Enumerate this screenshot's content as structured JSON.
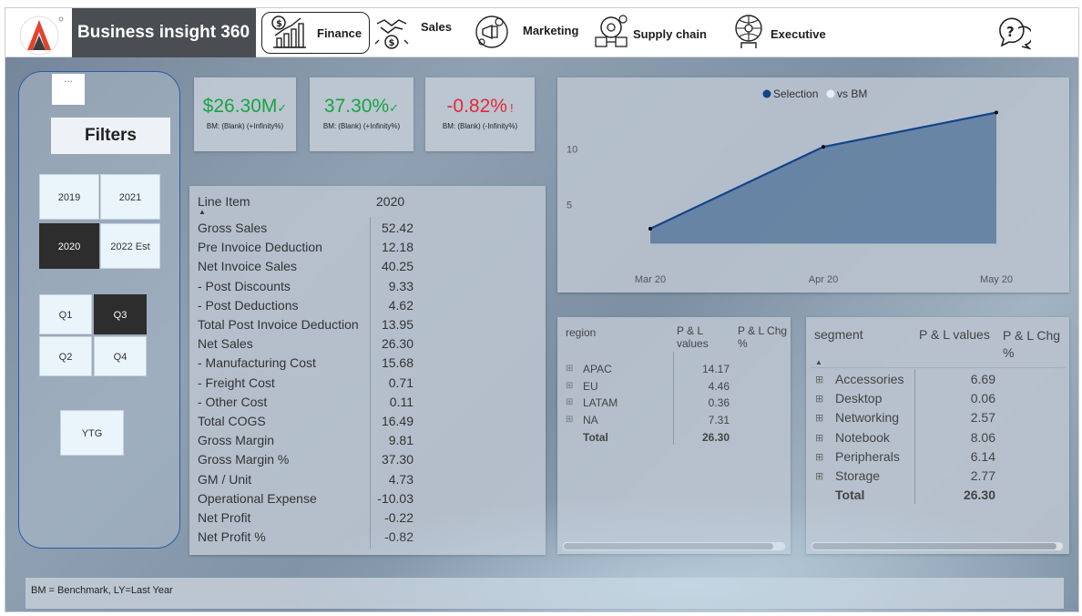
{
  "header": {
    "app_title": "Business insight 360",
    "nav": [
      {
        "label": "Finance",
        "icon": "finance-chart-icon"
      },
      {
        "label": "Sales",
        "icon": "handshake-icon"
      },
      {
        "label": "Marketing",
        "icon": "megaphone-icon"
      },
      {
        "label": "Supply chain",
        "icon": "supply-chain-icon"
      },
      {
        "label": "Executive",
        "icon": "executive-icon"
      }
    ],
    "help_icon": "help-chat-icon",
    "logo_icon": "brand-logo-icon"
  },
  "filters": {
    "more_label": "...",
    "title": "Filters",
    "years": [
      "2019",
      "2021",
      "2020",
      "2022 Est"
    ],
    "selected_year": "2020",
    "quarters": [
      "Q1",
      "Q3",
      "Q2",
      "Q4"
    ],
    "selected_quarter": "Q3",
    "ytg": "YTG"
  },
  "kpis": [
    {
      "value": "$26.30M",
      "indicator": "✓",
      "sub": "BM: (Blank) (+Infinity%)",
      "color": "#1aa342"
    },
    {
      "value": "37.30%",
      "indicator": "✓",
      "sub": "BM: (Blank) (+Infinity%)",
      "color": "#1aa342"
    },
    {
      "value": "-0.82%",
      "indicator": "!",
      "sub": "BM: (Blank) (-Infinity%)",
      "color": "#e02b3b"
    }
  ],
  "pl_table": {
    "col_label": "Line Item",
    "col_value": "2020",
    "rows": [
      {
        "label": "Gross Sales",
        "value": "52.42"
      },
      {
        "label": "Pre Invoice Deduction",
        "value": "12.18"
      },
      {
        "label": "Net Invoice Sales",
        "value": "40.25"
      },
      {
        "label": "- Post Discounts",
        "value": "9.33"
      },
      {
        "label": "- Post Deductions",
        "value": "4.62"
      },
      {
        "label": "Total Post Invoice Deduction",
        "value": "13.95"
      },
      {
        "label": "Net Sales",
        "value": "26.30"
      },
      {
        "label": "- Manufacturing Cost",
        "value": "15.68"
      },
      {
        "label": "- Freight Cost",
        "value": "0.71"
      },
      {
        "label": "- Other Cost",
        "value": "0.11"
      },
      {
        "label": "Total COGS",
        "value": "16.49"
      },
      {
        "label": "Gross Margin",
        "value": "9.81"
      },
      {
        "label": "Gross Margin %",
        "value": "37.30"
      },
      {
        "label": "GM / Unit",
        "value": "4.73"
      },
      {
        "label": "Operational Expense",
        "value": "-10.03"
      },
      {
        "label": "Net Profit",
        "value": "-0.22"
      },
      {
        "label": "Net Profit %",
        "value": "-0.82"
      }
    ]
  },
  "chart_data": {
    "type": "area",
    "categories": [
      "Mar 20",
      "Apr 20",
      "May 20"
    ],
    "series": [
      {
        "name": "Selection",
        "values": [
          2.8,
          10.2,
          13.3
        ],
        "color": "#13448a"
      },
      {
        "name": "vs BM",
        "values": [],
        "color": "#e8eef6"
      }
    ],
    "y_ticks": [
      "5",
      "10"
    ],
    "ylim": [
      0,
      14
    ],
    "legend_position": "top"
  },
  "region_table": {
    "headers": [
      "region",
      "P & L values",
      "P & L Chg %"
    ],
    "rows": [
      {
        "label": "APAC",
        "value": "14.17"
      },
      {
        "label": "EU",
        "value": "4.46"
      },
      {
        "label": "LATAM",
        "value": "0.36"
      },
      {
        "label": "NA",
        "value": "7.31"
      }
    ],
    "total_label": "Total",
    "total_value": "26.30"
  },
  "segment_table": {
    "headers": [
      "segment",
      "P & L values",
      "P & L Chg %"
    ],
    "rows": [
      {
        "label": "Accessories",
        "value": "6.69"
      },
      {
        "label": "Desktop",
        "value": "0.06"
      },
      {
        "label": "Networking",
        "value": "2.57"
      },
      {
        "label": "Notebook",
        "value": "8.06"
      },
      {
        "label": "Peripherals",
        "value": "6.14"
      },
      {
        "label": "Storage",
        "value": "2.77"
      }
    ],
    "total_label": "Total",
    "total_value": "26.30"
  },
  "footnote": "BM = Benchmark, LY=Last Year"
}
